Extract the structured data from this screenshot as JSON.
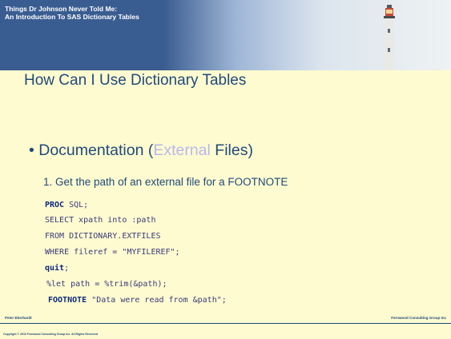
{
  "header": {
    "line1": "Things Dr Johnson Never Told Me:",
    "line2": "An Introduction To SAS Dictionary Tables"
  },
  "slide": {
    "title": "How Can I Use Dictionary Tables",
    "bullet": {
      "prefix": "Documentation (",
      "link": "External",
      "suffix": " Files)"
    },
    "numbered_item": "1.  Get the path of an external file for a FOOTNOTE"
  },
  "code": [
    {
      "kw": "PROC",
      "text": " SQL;"
    },
    {
      "kw": "",
      "text": "SELECT xpath into :path"
    },
    {
      "kw": "",
      "text": "FROM DICTIONARY.EXTFILES"
    },
    {
      "kw": "",
      "text": "WHERE fileref = \"MYFILEREF\";"
    },
    {
      "kw": "quit",
      "text": ";"
    },
    {
      "kw": "",
      "text": "%let path = %trim(&path);"
    },
    {
      "kw": "FOOTNOTE",
      "text": " \"Data were read from &path\";"
    }
  ],
  "footer": {
    "author": "Peter Eberhardt",
    "company": "Fernwood Consulting Group Inc",
    "copyright": "Copyright © 2010 Fernwood Consulting Group Inc. All Rights Reserved"
  },
  "colors": {
    "title": "#1f4a7a",
    "background": "#fffbd0",
    "header": "#3a5d91",
    "link": "#b7b7f0"
  }
}
